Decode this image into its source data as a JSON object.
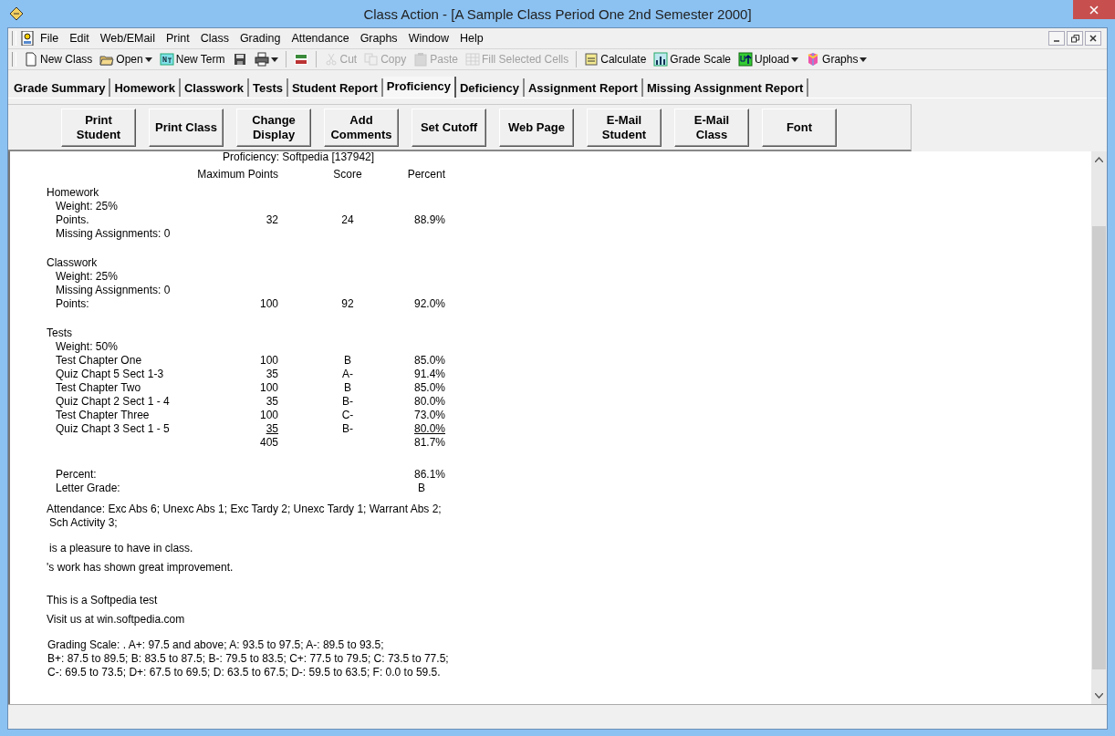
{
  "window": {
    "title": "Class Action - [A Sample Class Period One 2nd Semester 2000]"
  },
  "menu": [
    "File",
    "Edit",
    "Web/EMail",
    "Print",
    "Class",
    "Grading",
    "Attendance",
    "Graphs",
    "Window",
    "Help"
  ],
  "toolbar": [
    {
      "label": "New Class",
      "disabled": false,
      "dropdown": false
    },
    {
      "label": "Open",
      "disabled": false,
      "dropdown": true
    },
    {
      "label": "New Term",
      "disabled": false,
      "dropdown": false
    },
    {
      "disabled": false,
      "dropdown": false
    },
    {
      "disabled": false,
      "dropdown": true
    },
    {
      "disabled": false,
      "dropdown": false
    },
    {
      "label": "Cut",
      "disabled": true,
      "dropdown": false
    },
    {
      "label": "Copy",
      "disabled": true,
      "dropdown": false
    },
    {
      "label": "Paste",
      "disabled": true,
      "dropdown": false
    },
    {
      "label": "Fill Selected Cells",
      "disabled": true,
      "dropdown": false
    },
    {
      "label": "Calculate",
      "disabled": false,
      "dropdown": false
    },
    {
      "label": "Grade Scale",
      "disabled": false,
      "dropdown": false
    },
    {
      "label": "Upload",
      "disabled": false,
      "dropdown": true
    },
    {
      "label": "Graphs",
      "disabled": false,
      "dropdown": true
    }
  ],
  "tabs": [
    {
      "label": "Grade Summary",
      "selected": false
    },
    {
      "label": "Homework",
      "selected": false
    },
    {
      "label": "Classwork",
      "selected": false
    },
    {
      "label": "Tests",
      "selected": false
    },
    {
      "label": "Student Report",
      "selected": false
    },
    {
      "label": "Proficiency",
      "selected": true
    },
    {
      "label": "Deficiency",
      "selected": false
    },
    {
      "label": "Assignment Report",
      "selected": false
    },
    {
      "label": "Missing Assignment Report",
      "selected": false
    }
  ],
  "actions": [
    [
      "Print",
      "Student"
    ],
    [
      "Print Class"
    ],
    [
      "Change",
      "Display"
    ],
    [
      "Add",
      "Comments"
    ],
    [
      "Set Cutoff"
    ],
    [
      "Web Page"
    ],
    [
      "E-Mail",
      "Student"
    ],
    [
      "E-Mail",
      "Class"
    ],
    [
      "Font"
    ]
  ],
  "report": {
    "header": "Proficiency:  Softpedia [137942]",
    "columns": [
      "Maximum Points",
      "Score",
      "Percent"
    ],
    "sections": [
      {
        "title": "Homework",
        "lines": [
          {
            "label": "Weight:  25%"
          },
          {
            "label": "Points.",
            "max": "32",
            "score": "24",
            "percent": "88.9%"
          },
          {
            "label": "Missing Assignments:  0"
          }
        ]
      },
      {
        "title": "Classwork",
        "lines": [
          {
            "label": "Weight:  25%"
          },
          {
            "label": "Missing Assignments:  0"
          },
          {
            "label": "Points:",
            "max": "100",
            "score": "92",
            "percent": "92.0%"
          }
        ]
      },
      {
        "title": "Tests",
        "lines": [
          {
            "label": "Weight:  50%"
          },
          {
            "label": "Test Chapter One",
            "max": "100",
            "score": "B",
            "percent": "85.0%"
          },
          {
            "label": "Quiz Chapt 5 Sect 1-3",
            "max": "35",
            "score": "A-",
            "percent": "91.4%"
          },
          {
            "label": "Test Chapter Two",
            "max": "100",
            "score": "B",
            "percent": "85.0%"
          },
          {
            "label": "Quiz Chapt 2 Sect 1 - 4",
            "max": "35",
            "score": "B-",
            "percent": "80.0%"
          },
          {
            "label": "Test Chapter Three",
            "max": "100",
            "score": "C-",
            "percent": "73.0%"
          },
          {
            "label": "Quiz Chapt 3 Sect 1 - 5",
            "max": "35",
            "score": "B-",
            "percent": "80.0%",
            "underlined": true
          },
          {
            "max": "405",
            "percent": "81.7%"
          }
        ]
      }
    ],
    "summary": [
      {
        "label": "Percent:",
        "value": "86.1%"
      },
      {
        "label": "Letter Grade:",
        "value": "B"
      }
    ],
    "attendance": [
      "Attendance:  Exc Abs 6; Unexc Abs 1; Exc Tardy 2; Unexc Tardy 1; Warrant Abs 2;",
      "Sch Activity 3;"
    ],
    "comments": [
      "is a pleasure to have in class.",
      "'s work has shown great improvement."
    ],
    "notes": [
      "This is a Softpedia test",
      "Visit us at win.softpedia.com"
    ],
    "grading_scale": [
      "Grading Scale: .  A+: 97.5 and above;  A: 93.5 to  97.5; A-: 89.5 to  93.5;",
      "B+: 87.5 to  89.5; B: 83.5 to  87.5; B-: 79.5 to  83.5; C+: 77.5 to  79.5; C: 73.5 to  77.5;",
      "C-: 69.5 to  73.5; D+: 67.5 to  69.5; D: 63.5 to  67.5; D-: 59.5 to  63.5; F: 0.0 to  59.5."
    ]
  }
}
